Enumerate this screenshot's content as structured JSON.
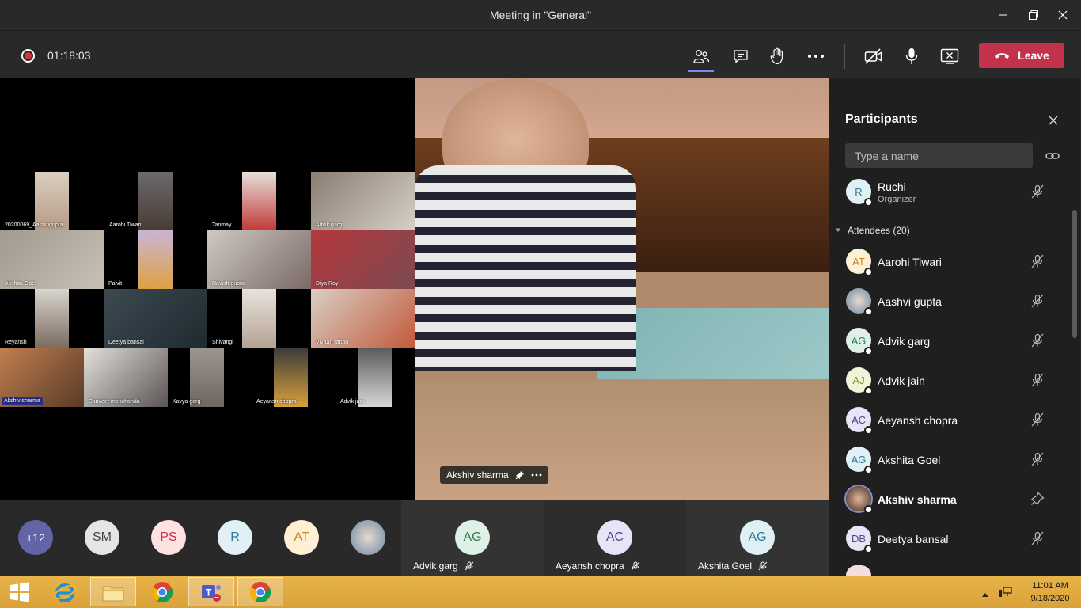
{
  "window": {
    "title": "Meeting in \"General\""
  },
  "toolbar": {
    "timer": "01:18:03",
    "leave_label": "Leave"
  },
  "grid_tiles": [
    "20200069_Aashvigupta",
    "Aarohi Tiwari",
    "Tanmay",
    "Advik garg",
    "Akshita Goel",
    "Palvit",
    "Navish gupta",
    "Diya Roy",
    "Reyansh",
    "Deetya bansal",
    "Shivangi",
    "Vivaan rattan",
    "Akshiv sharma",
    "Sanveer manchanda",
    "Kavya garg",
    "Aeyansh chopra",
    "Advik jain"
  ],
  "spotlight": {
    "name": "Akshiv sharma"
  },
  "strip": {
    "overflow": "+12",
    "avatars": [
      "SM",
      "PS",
      "R",
      "AT"
    ],
    "cells": [
      {
        "initials": "AG",
        "name": "Advik garg"
      },
      {
        "initials": "AC",
        "name": "Aeyansh chopra"
      },
      {
        "initials": "AG",
        "name": "Akshita Goel"
      }
    ]
  },
  "participants": {
    "title": "Participants",
    "search_placeholder": "Type a name",
    "organizer": {
      "initials": "R",
      "name": "Ruchi",
      "role": "Organizer"
    },
    "attendees_label": "Attendees (20)",
    "attendees": [
      {
        "initials": "AT",
        "name": "Aarohi Tiwari"
      },
      {
        "initials": "",
        "name": "Aashvi gupta"
      },
      {
        "initials": "AG",
        "name": "Advik garg"
      },
      {
        "initials": "AJ",
        "name": "Advik jain"
      },
      {
        "initials": "AC",
        "name": "Aeyansh chopra"
      },
      {
        "initials": "AG",
        "name": "Akshita Goel"
      },
      {
        "initials": "",
        "name": "Akshiv sharma"
      },
      {
        "initials": "DB",
        "name": "Deetya bansal"
      }
    ]
  },
  "taskbar": {
    "time": "11:01 AM",
    "date": "9/18/2020"
  }
}
